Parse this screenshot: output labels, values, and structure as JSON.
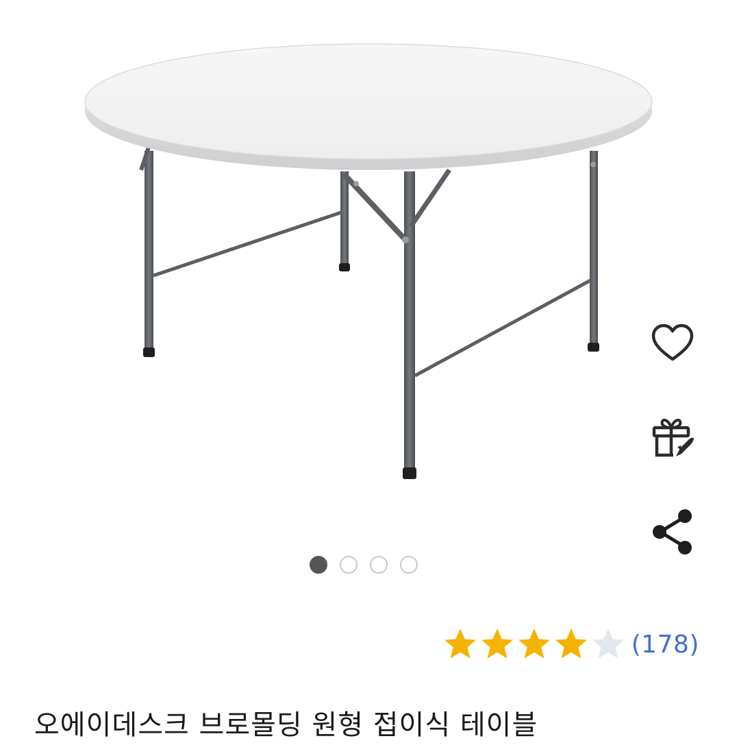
{
  "product": {
    "title": "오에이데스크 브로몰딩 원형 접이식 테이블",
    "image_alt": "round white folding table",
    "rating": 4,
    "rating_max": 5,
    "review_count": "(178)"
  },
  "carousel": {
    "total": 4,
    "active_index": 0
  },
  "actions": {
    "icons": [
      "heart-icon",
      "gift-rocket-icon",
      "share-icon"
    ]
  },
  "colors": {
    "star_filled": "#F5B301",
    "star_empty": "#E3E7EE",
    "review_link": "#3F6FD1",
    "active_dot": "#555555",
    "inactive_dot": "#C9C9C9",
    "frame": "#5E6165",
    "tabletop": "#F3F3F4"
  }
}
